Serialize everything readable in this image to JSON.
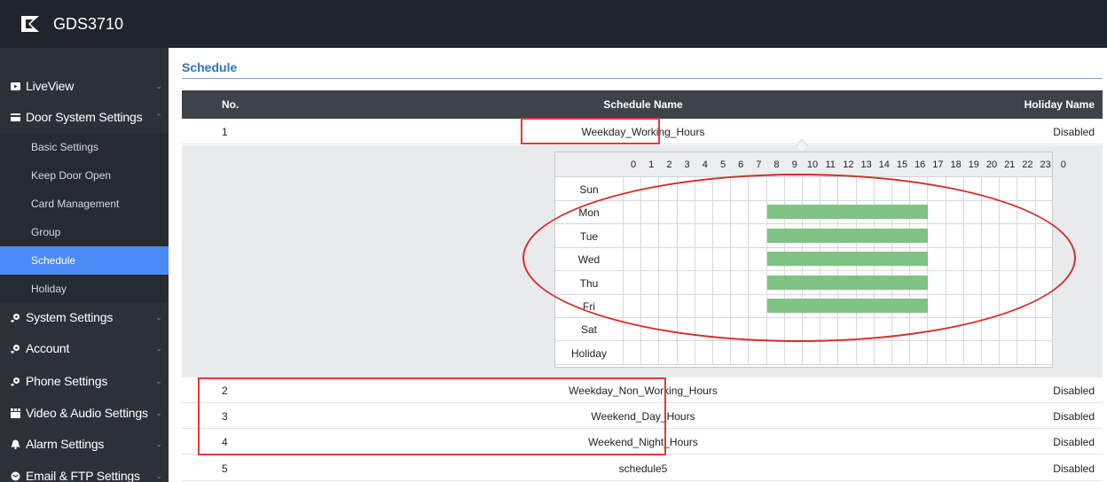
{
  "app": {
    "title": "GDS3710",
    "logo_icon": "grandstream-logo"
  },
  "sidebar": {
    "groups": [
      {
        "label": "LiveView",
        "icon": "video-icon"
      },
      {
        "label": "Door System Settings",
        "icon": "card-icon",
        "expanded": true
      },
      {
        "label": "System Settings",
        "icon": "gear-icon"
      },
      {
        "label": "Account",
        "icon": "gear-icon"
      },
      {
        "label": "Phone Settings",
        "icon": "gear-icon"
      },
      {
        "label": "Video & Audio Settings",
        "icon": "film-icon"
      },
      {
        "label": "Alarm Settings",
        "icon": "bell-icon"
      },
      {
        "label": "Email & FTP Settings",
        "icon": "mail-icon"
      }
    ],
    "subitems": [
      {
        "label": "Basic Settings"
      },
      {
        "label": "Keep Door Open"
      },
      {
        "label": "Card Management"
      },
      {
        "label": "Group"
      },
      {
        "label": "Schedule",
        "active": true
      },
      {
        "label": "Holiday"
      }
    ]
  },
  "page": {
    "title": "Schedule"
  },
  "table": {
    "headers": {
      "no": "No.",
      "name": "Schedule Name",
      "holiday": "Holiday Name"
    },
    "rows": [
      {
        "no": "1",
        "name": "Weekday_Working_Hours",
        "holiday": "Disabled"
      },
      {
        "no": "2",
        "name": "Weekday_Non_Working_Hours",
        "holiday": "Disabled"
      },
      {
        "no": "3",
        "name": "Weekend_Day_Hours",
        "holiday": "Disabled"
      },
      {
        "no": "4",
        "name": "Weekend_Night_Hours",
        "holiday": "Disabled"
      },
      {
        "no": "5",
        "name": "schedule5",
        "holiday": "Disabled"
      }
    ]
  },
  "schedule_grid": {
    "hours": [
      "0",
      "1",
      "2",
      "3",
      "4",
      "5",
      "6",
      "7",
      "8",
      "9",
      "10",
      "11",
      "12",
      "13",
      "14",
      "15",
      "16",
      "17",
      "18",
      "19",
      "20",
      "21",
      "22",
      "23",
      "0"
    ],
    "days": [
      "Sun",
      "Mon",
      "Tue",
      "Wed",
      "Thu",
      "Fri",
      "Sat",
      "Holiday"
    ],
    "active_ranges": [
      {
        "day": "Mon",
        "start": 8,
        "end": 17
      },
      {
        "day": "Tue",
        "start": 8,
        "end": 17
      },
      {
        "day": "Wed",
        "start": 8,
        "end": 17
      },
      {
        "day": "Thu",
        "start": 8,
        "end": 17
      },
      {
        "day": "Fri",
        "start": 8,
        "end": 17
      }
    ],
    "active_color": "#7fc283"
  },
  "colors": {
    "header_bg": "#20242b",
    "sidebar_bg": "#2c3139",
    "active_item": "#4a8af4",
    "title_blue": "#2a74c0",
    "annotation_red": "#e23a3a"
  }
}
